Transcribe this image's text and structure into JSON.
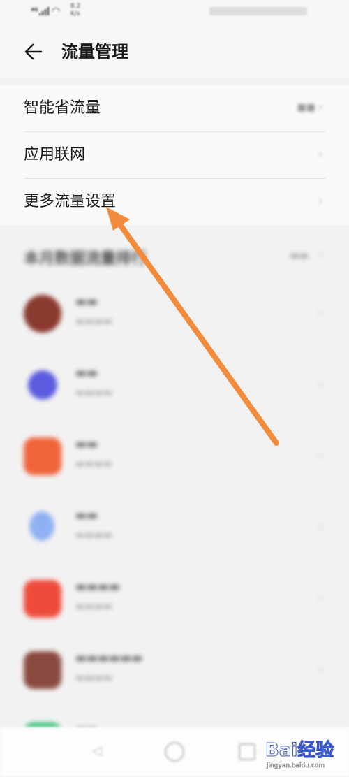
{
  "status_bar": {
    "network": "4G",
    "speed_value": "8.2",
    "speed_unit": "K/s"
  },
  "header": {
    "title": "流量管理"
  },
  "settings": [
    {
      "label": "智能省流量"
    },
    {
      "label": "应用联网"
    },
    {
      "label": "更多流量设置"
    }
  ],
  "ranking": {
    "title": "本月数据流量排行",
    "apps": [
      {
        "icon": "app-avatar-icon",
        "color": "#8a3a2e"
      },
      {
        "icon": "app-circle-icon",
        "color": "#5b5be0"
      },
      {
        "icon": "app-orange-icon",
        "color": "#f0643a"
      },
      {
        "icon": "app-baidu-icon",
        "color": "#8fb0f2"
      },
      {
        "icon": "app-red-icon",
        "color": "#ee4b3a"
      },
      {
        "icon": "app-brown-icon",
        "color": "#8a4a3f"
      },
      {
        "icon": "app-green-icon",
        "color": "#3cc47a"
      }
    ]
  },
  "annotation": {
    "arrow_color": "#f28c3c"
  },
  "watermark": {
    "logo": "Bai经验",
    "site": "jingyan.baidu.com"
  }
}
